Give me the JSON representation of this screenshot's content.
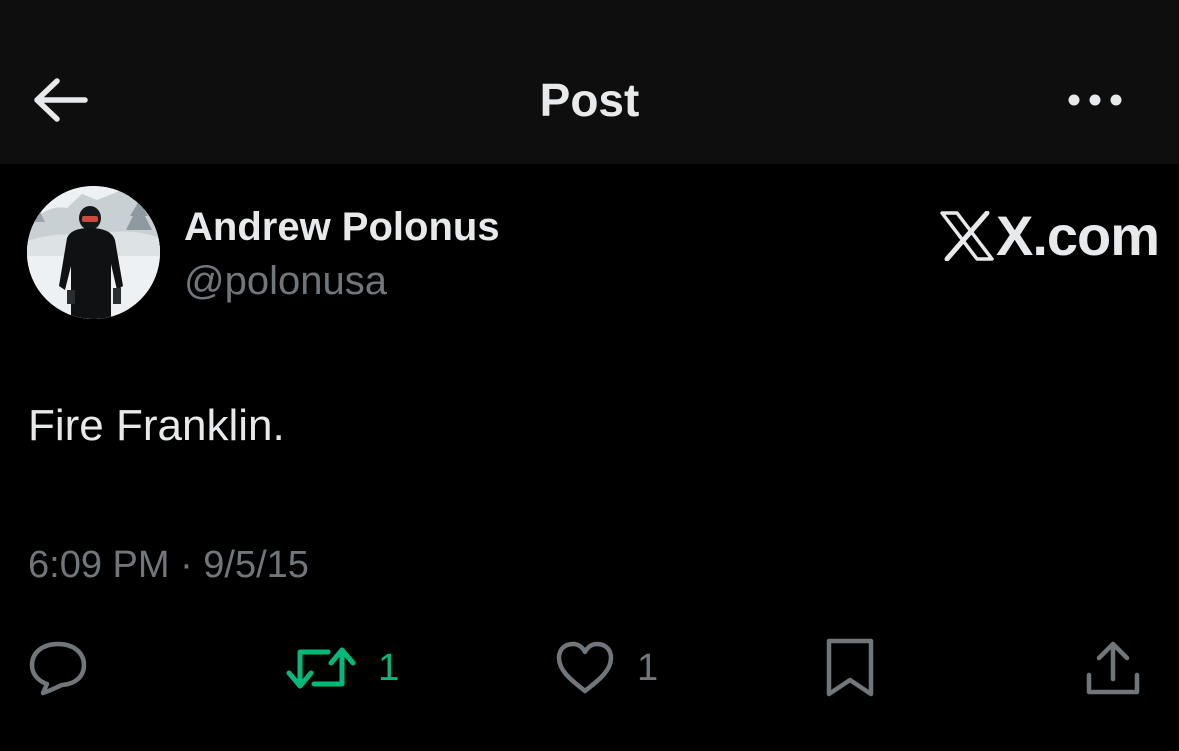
{
  "header": {
    "title": "Post",
    "back_icon": "arrow-left-icon",
    "more_icon": "ellipsis-icon"
  },
  "post": {
    "author": {
      "display_name": "Andrew Polonus",
      "handle": "@polonusa"
    },
    "brand": "X.com",
    "text": "Fire Franklin.",
    "timestamp": "6:09 PM · 9/5/15"
  },
  "actions": {
    "reply": {
      "icon": "reply-bubble-icon"
    },
    "repost": {
      "icon": "repost-icon",
      "count": "1",
      "active": true
    },
    "like": {
      "icon": "heart-icon",
      "count": "1"
    },
    "bookmark": {
      "icon": "bookmark-icon"
    },
    "share": {
      "icon": "share-upload-icon"
    }
  },
  "colors": {
    "background": "#000000",
    "header_background": "#0e0e0e",
    "primary_text": "#e7e9ea",
    "secondary_text": "#71767b",
    "repost_active": "#00ba7c"
  }
}
